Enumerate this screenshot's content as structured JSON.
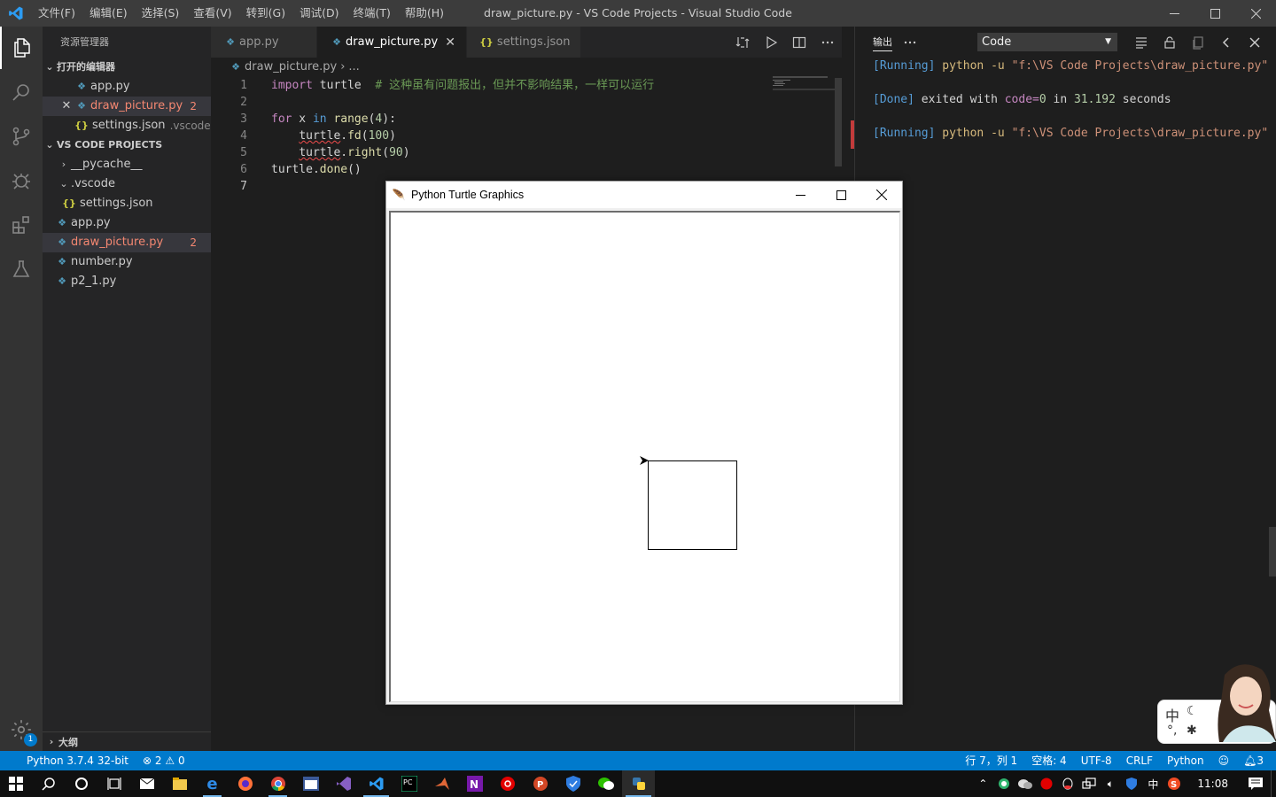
{
  "window": {
    "title": "draw_picture.py - VS Code Projects - Visual Studio Code",
    "menu": [
      "文件(F)",
      "编辑(E)",
      "选择(S)",
      "查看(V)",
      "转到(G)",
      "调试(D)",
      "终端(T)",
      "帮助(H)"
    ]
  },
  "activity": {
    "settings_badge": "1"
  },
  "sidebar": {
    "title": "资源管理器",
    "open_editors_header": "打开的编辑器",
    "open_editors": [
      {
        "name": "app.py"
      },
      {
        "name": "draw_picture.py",
        "problems": "2"
      },
      {
        "name": "settings.json",
        "hint": ".vscode"
      }
    ],
    "project_header": "VS CODE PROJECTS",
    "tree": [
      {
        "name": "__pycache__"
      },
      {
        "name": ".vscode"
      },
      {
        "name": "settings.json"
      },
      {
        "name": "app.py"
      },
      {
        "name": "draw_picture.py",
        "problems": "2"
      },
      {
        "name": "number.py"
      },
      {
        "name": "p2_1.py"
      }
    ],
    "outline_header": "大纲"
  },
  "tabs": [
    {
      "label": "app.py"
    },
    {
      "label": "draw_picture.py"
    },
    {
      "label": "settings.json"
    }
  ],
  "breadcrumb": {
    "file": "draw_picture.py",
    "rest": "..."
  },
  "code": {
    "line_numbers": [
      "1",
      "2",
      "3",
      "4",
      "5",
      "6",
      "7"
    ],
    "l1_kw": "import",
    "l1_mod": " turtle  ",
    "l1_comment": "# 这种虽有问题报出，但并不影响结果，一样可以运行",
    "l3_for": "for",
    "l3_x": " x ",
    "l3_in": "in",
    "l3_range": "range",
    "l3_arg_open": "(",
    "l3_num": "4",
    "l3_close": "):",
    "l4_obj": "turtle",
    "l4_dot": ".",
    "l4_fn": "fd",
    "l4_open": "(",
    "l4_num": "100",
    "l4_close": ")",
    "l5_obj": "turtle",
    "l5_dot": ".",
    "l5_fn": "right",
    "l5_open": "(",
    "l5_num": "90",
    "l5_close": ")",
    "l6_obj": "turtle",
    "l6_dot": ".",
    "l6_fn": "done",
    "l6_call": "()"
  },
  "panel": {
    "tab": "输出",
    "channel": "Code",
    "running_tag": "[Running]",
    "cmd": "python -u",
    "path": "\"f:\\VS Code Projects\\draw_picture.py\"",
    "done_tag": "[Done]",
    "exited": "exited with",
    "code_kw": "code=",
    "code_val": "0",
    "in_word": "in",
    "seconds_val": "31.192",
    "seconds": "seconds"
  },
  "turtle": {
    "title": "Python Turtle Graphics"
  },
  "status": {
    "interpreter": "Python 3.7.4 32-bit",
    "errors": "2",
    "warnings": "0",
    "position": "行 7，列 1",
    "indent": "空格: 4",
    "encoding": "UTF-8",
    "eol": "CRLF",
    "language": "Python",
    "notifications": "3"
  },
  "ime": {
    "mode": "中"
  },
  "taskbar": {
    "time": "11:08",
    "ime_tray": "中"
  },
  "colors": {
    "accent": "#007acc",
    "error": "#f48771"
  }
}
